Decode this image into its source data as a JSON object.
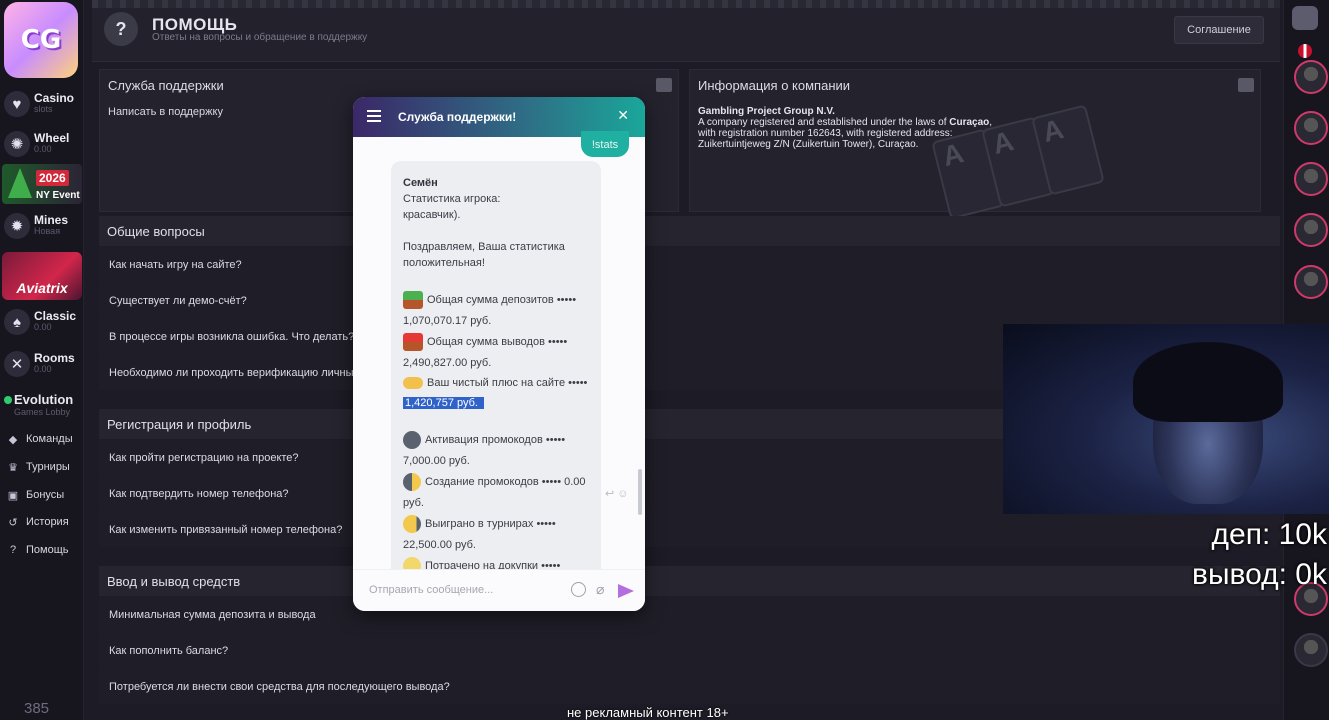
{
  "header": {
    "title": "ПОМОЩЬ",
    "subtitle": "Ответы на вопросы и обращение в поддержку",
    "agreement_label": "Соглашение"
  },
  "sidebar": {
    "logo_text": "CG",
    "games": [
      {
        "name": "Casino",
        "sub": "slots",
        "icon": "casino-icon"
      },
      {
        "name": "Wheel",
        "sub": "0.00",
        "icon": "wheel-icon"
      },
      {
        "name": "Mines",
        "sub": "Новая",
        "icon": "mines-icon"
      },
      {
        "name": "Classic",
        "sub": "0.00",
        "icon": "classic-icon"
      },
      {
        "name": "Rooms",
        "sub": "0.00",
        "icon": "rooms-icon"
      }
    ],
    "ny_event": {
      "year": "2026",
      "label": "NY Event"
    },
    "aviatrix_label": "Aviatrix",
    "evolution": {
      "name": "Evolution",
      "sub": "Games Lobby"
    },
    "menu": [
      {
        "label": "Команды",
        "icon": "teams-icon"
      },
      {
        "label": "Турниры",
        "icon": "trophy-icon"
      },
      {
        "label": "Бонусы",
        "icon": "gift-icon"
      },
      {
        "label": "История",
        "icon": "history-icon"
      },
      {
        "label": "Помощь",
        "icon": "help-icon"
      }
    ],
    "online_count": "385"
  },
  "support_panel": {
    "title": "Служба поддержки",
    "link": "Написать в поддержку"
  },
  "company_panel": {
    "title": "Информация о компании",
    "company_name": "Gambling Project Group N.V.",
    "line1_pre": "A company registered and established under the laws of ",
    "line1_bold": "Curaçao",
    "line1_post": ",",
    "line2": "with registration number 162643, with registered address:",
    "line3": "Zuikertuintjeweg Z/N (Zuikertuin Tower), Curaçao."
  },
  "sections": [
    {
      "title": "Общие вопросы",
      "questions": [
        "Как начать игру на сайте?",
        "Существует ли демо-счёт?",
        "В процессе игры возникла ошибка. Что делать?",
        "Необходимо ли проходить верификацию личных"
      ]
    },
    {
      "title": "Регистрация и профиль",
      "questions": [
        "Как пройти регистрацию на проекте?",
        "Как подтвердить номер телефона?",
        "Как изменить привязанный номер телефона?"
      ]
    },
    {
      "title": "Ввод и вывод средств",
      "questions": [
        "Минимальная сумма депозита и вывода",
        "Как пополнить баланс?",
        "Потребуется ли внести свои средства для последующего вывода?"
      ]
    }
  ],
  "chat": {
    "title": "Служба поддержки!",
    "prev_message": "!stats",
    "sender": "Семён",
    "line_stats": "Статистика игрока:",
    "line_nick": "красавчик).",
    "line_congrats1": "Поздравляем, Ваша статистика",
    "line_congrats2": "положительная!",
    "deposits_label": "Общая сумма депозитов •••••",
    "deposits_value": "1,070,070.17 руб.",
    "withdrawals_label": "Общая сумма выводов •••••",
    "withdrawals_value": "2,490,827.00 руб.",
    "net_label": "Ваш чистый плюс на сайте •••••",
    "net_value": "1,420,757 руб.",
    "promo_act_label": "Активация промокодов •••••",
    "promo_act_value": "7,000.00 руб.",
    "promo_create_label": "Создание промокодов ••••• 0.00",
    "promo_create_value": "руб.",
    "tournaments_label": "Выиграно в турнирах •••••",
    "tournaments_value": "22,500.00 руб.",
    "extras_label": "Потрачено на докупки •••••",
    "input_placeholder": "Отправить сообщение..."
  },
  "stream_overlay": {
    "dep_text": "деп: 10k",
    "wd_text": "вывод: 0k",
    "caption": "не рекламный контент 18+"
  },
  "colors": {
    "background": "#1c1b26",
    "panel": "#23222d",
    "chat_header_start": "#3b2868",
    "chat_header_end": "#1aa79a",
    "highlight": "#3063c9",
    "send_button": "#b36ee0"
  }
}
